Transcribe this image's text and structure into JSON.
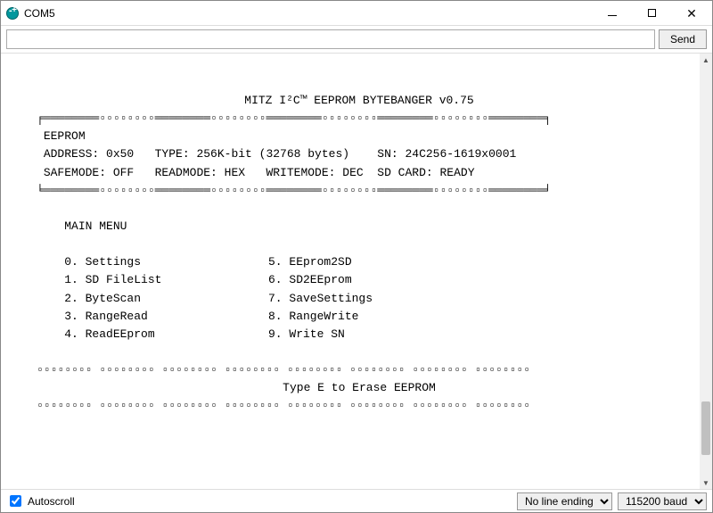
{
  "window": {
    "title": "COM5"
  },
  "toolbar": {
    "send_label": "Send",
    "input_value": ""
  },
  "terminal": {
    "title_line": "MITZ I²C™ EEPROM BYTEBANGER v0.75",
    "rule_top": "╒════════▫▫▫▫▫▫▫▫════════▫▫▫▫▫▫▫▫════════▫▫▫▫▫▫▫▫════════▫▫▫▫▫▫▫▫════════╕",
    "eeprom_label": "EEPROM",
    "info_line1": "ADDRESS: 0x50   TYPE: 256K-bit (32768 bytes)    SN: 24C256-1619x0001",
    "info_line2": "SAFEMODE: OFF   READMODE: HEX   WRITEMODE: DEC  SD CARD: READY",
    "rule_mid": "╘════════▫▫▫▫▫▫▫▫════════▫▫▫▫▫▫▫▫════════▫▫▫▫▫▫▫▫════════▫▫▫▫▫▫▫▫════════╛",
    "main_menu": "MAIN MENU",
    "menu_left": [
      "0. Settings",
      "1. SD FileList",
      "2. ByteScan",
      "3. RangeRead",
      "4. ReadEEprom"
    ],
    "menu_right": [
      "5. EEprom2SD",
      "6. SD2EEprom",
      "7. SaveSettings",
      "8. RangeWrite",
      "9. Write SN"
    ],
    "rule_long": "▫▫▫▫▫▫▫▫ ▫▫▫▫▫▫▫▫ ▫▫▫▫▫▫▫▫ ▫▫▫▫▫▫▫▫ ▫▫▫▫▫▫▫▫ ▫▫▫▫▫▫▫▫ ▫▫▫▫▫▫▫▫ ▫▫▫▫▫▫▫▫",
    "erase_hint": "Type E to Erase EEPROM"
  },
  "statusbar": {
    "autoscroll_label": "Autoscroll",
    "autoscroll_checked": true,
    "line_ending": "No line ending",
    "baud": "115200 baud"
  }
}
